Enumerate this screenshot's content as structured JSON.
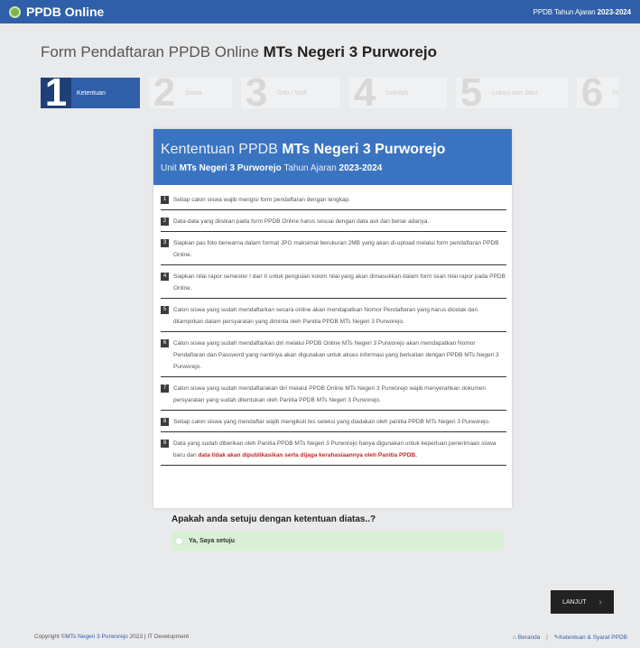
{
  "header": {
    "brand": "PPDB Online",
    "right_prefix": "PPDB Tahun Ajaran",
    "right_year": "2023-2024",
    "colors": {
      "bar": "#2f5fa8",
      "logo": "#7fb24a"
    },
    "logo_icon": "school-logo-icon"
  },
  "page": {
    "title_prefix": "Form Pendaftaran PPDB Online",
    "title_school": "MTs Negeri 3 Purworejo"
  },
  "steps": [
    {
      "num": "1",
      "label": "Ketentuan",
      "active": true
    },
    {
      "num": "2",
      "label": "Siswa",
      "active": false
    },
    {
      "num": "3",
      "label": "Ortu / Wali",
      "active": false
    },
    {
      "num": "4",
      "label": "Sekolah",
      "active": false
    },
    {
      "num": "5",
      "label": "Lokasi dan Jalur",
      "active": false
    },
    {
      "num": "6",
      "label": "N",
      "active": false
    }
  ],
  "card": {
    "title_prefix": "Kententuan PPDB",
    "title_school": "MTs Negeri 3 Purworejo",
    "sub_prefix": "Unit",
    "sub_school": "MTs Negeri 3 Purworejo",
    "sub_mid": "Tahun Ajaran",
    "sub_year": "2023-2024",
    "header_color": "#3a74c1"
  },
  "rules": [
    {
      "n": "1",
      "text": "Setiap calon siswa wajib mengisi form pendaftaran dengan lengkap."
    },
    {
      "n": "2",
      "text": "Data-data yang diisikan pada form PPDB Online harus sesuai dengan data asli dan benar adanya."
    },
    {
      "n": "3",
      "text": "Siapkan pas foto berwarna dalam format JPG maksimal berukuran 2MB yang akan di-upload melalui form pendaftaran PPDB Online."
    },
    {
      "n": "4",
      "text": "Siapkan nilai rapor semester I dan II untuk pengisian kolom nilai yang akan dimasukkan dalam form isian nilai rapor pada PPDB Online."
    },
    {
      "n": "5",
      "text": "Calon siswa yang sudah mendaftarkan secara online akan mendapatkan Nomor Pendaftaran yang harus dicetak dan dilampirkan dalam persyaratan yang diminta oleh Panitia PPDB MTs Negeri 3 Purworejo."
    },
    {
      "n": "6",
      "text": "Calon siswa yang sudah mendaftarkan diri melalui PPDB Online MTs Negeri 3 Purworejo akan mendapatkan Nomor Pendaftaran dan Password yang nantinya akan digunakan untuk akses informasi yang berkaitan dengan PPDB MTs Negeri 3 Purworejo."
    },
    {
      "n": "7",
      "text": "Calon siswa yang sudah mendaftarakan diri melalui PPDB Online MTs Negeri 3 Purworejo wajib menyerahkan dokumen persyaratan yang sudah ditentukan oleh Panitia PPDB MTs Negeri 3 Purworejo."
    },
    {
      "n": "8",
      "text": "Setiap calon siswa yang mendaftar wajib mengikuti tes seleksi yang diadakan oleh panitia PPDB MTs Negeri 3 Purworejo."
    },
    {
      "n": "9",
      "text": "Data yang sudah diberikan oleh Panitia PPDB MTs Negeri 3 Purworejo hanya digunakan untuk keperluan penerimaan siswa baru dan",
      "warn": "data tidak akan dipublikasikan serta dijaga kerahasiaannya oleh Panitia PPDB."
    }
  ],
  "agreement": {
    "question": "Apakah anda setuju dengan ketentuan diatas..?",
    "option": "Ya, Saya setuju",
    "bg_color": "#d9f0d6"
  },
  "next_button": {
    "label": "LANJUT",
    "icon": "chevron-right-icon"
  },
  "footer": {
    "copy_prefix": "Copyright ©",
    "copy_link": "MTs Negeri 3 Purworejo",
    "copy_suffix": "2023 | IT Development",
    "nav": [
      {
        "icon": "home-icon",
        "label": "Beranda"
      },
      {
        "icon": "wrench-icon",
        "label": "Ketentuan & Syarat PPDB"
      }
    ]
  }
}
